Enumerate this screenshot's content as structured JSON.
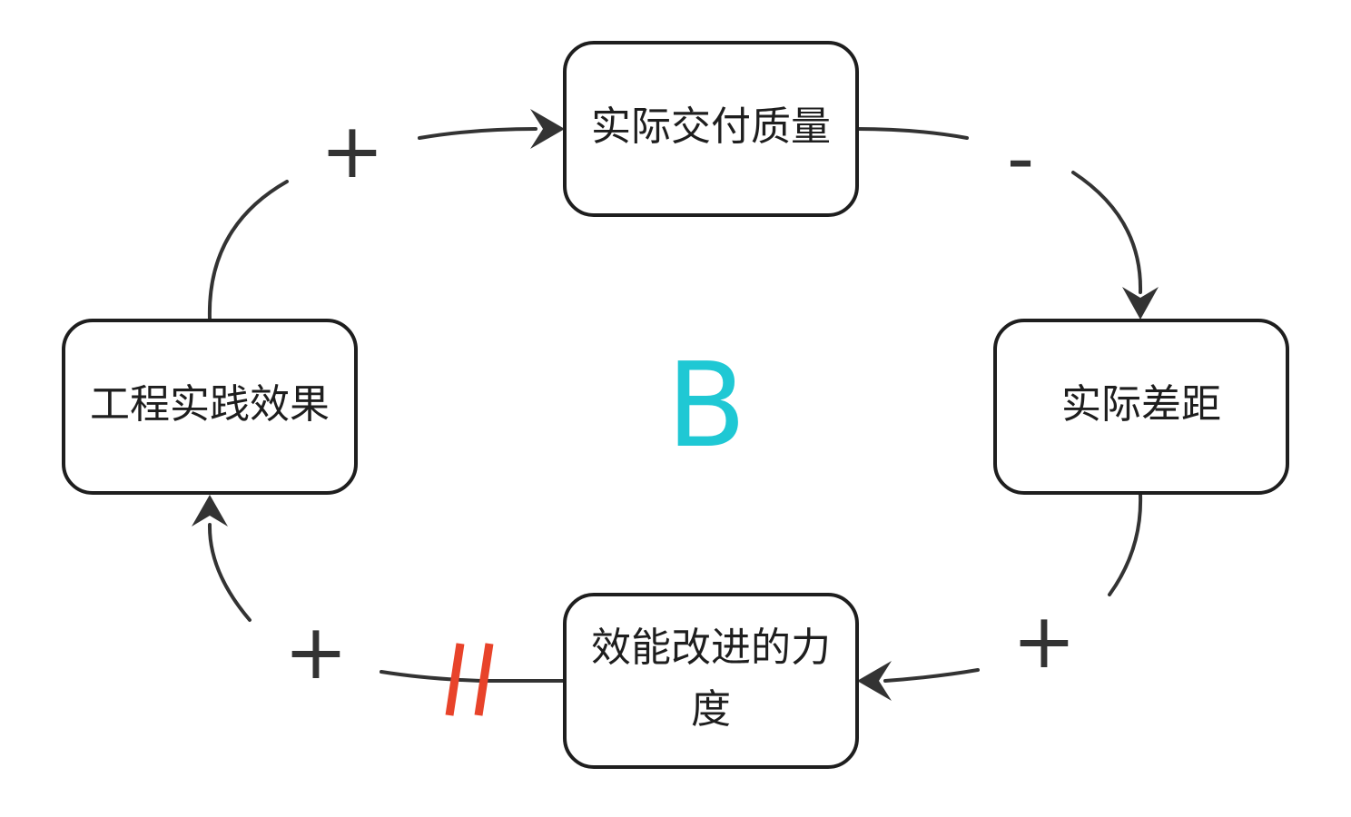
{
  "loop": {
    "label": "B",
    "color": "#1fc8d4"
  },
  "nodes": {
    "quality": {
      "label": "实际交付质量"
    },
    "gap": {
      "label": "实际差距"
    },
    "effort_line1": "效能改进的力",
    "effort_line2": "度",
    "practice": {
      "label": "工程实践效果"
    }
  },
  "links": {
    "quality_to_gap": {
      "polarity": "-"
    },
    "gap_to_effort": {
      "polarity": "+"
    },
    "effort_to_practice": {
      "polarity": "+",
      "delay": true
    },
    "practice_to_quality": {
      "polarity": "+"
    }
  },
  "colors": {
    "line": "#333333",
    "node_border": "#1e1e1e",
    "delay_mark": "#e8432a"
  }
}
